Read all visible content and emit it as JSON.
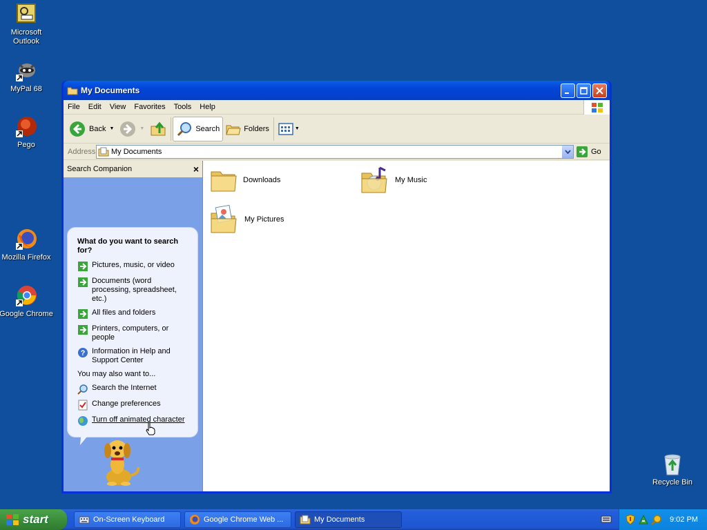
{
  "desktop": {
    "icons": [
      {
        "label": "Microsoft Outlook",
        "icon": "outlook-icon"
      },
      {
        "label": "MyPal 68",
        "icon": "mypal-icon"
      },
      {
        "label": "Pego",
        "icon": "pego-icon"
      },
      {
        "label": "Mozilla Firefox",
        "icon": "firefox-icon"
      },
      {
        "label": "Google Chrome",
        "icon": "chrome-icon"
      },
      {
        "label": "Recycle Bin",
        "icon": "recycle-bin-icon"
      }
    ]
  },
  "window": {
    "title": "My Documents",
    "menu": [
      "File",
      "Edit",
      "View",
      "Favorites",
      "Tools",
      "Help"
    ],
    "toolbar": {
      "back": "Back",
      "search": "Search",
      "folders": "Folders"
    },
    "address": {
      "label": "Address",
      "value": "My Documents",
      "go": "Go"
    },
    "companion": {
      "header": "Search Companion",
      "close": "×",
      "question": "What do you want to search for?",
      "options": [
        "Pictures, music, or video",
        "Documents (word processing, spreadsheet, etc.)",
        "All files and folders",
        "Printers, computers, or people",
        "Information in Help and Support Center"
      ],
      "also_heading": "You may also want to...",
      "also": [
        "Search the Internet",
        "Change preferences",
        "Turn off animated character"
      ]
    },
    "files": [
      {
        "name": "Downloads",
        "icon": "folder-icon"
      },
      {
        "name": "My Music",
        "icon": "music-folder-icon"
      },
      {
        "name": "My Pictures",
        "icon": "pictures-folder-icon"
      }
    ]
  },
  "taskbar": {
    "start": "start",
    "tasks": [
      "On-Screen Keyboard",
      "Google Chrome Web ...",
      "My Documents"
    ],
    "clock": "9:02 PM"
  },
  "colors": {
    "desktop": "#0f4f9e",
    "titlebar": "#0a5fe8",
    "companion": "#7aa0e8",
    "start": "#3c8f3c"
  }
}
